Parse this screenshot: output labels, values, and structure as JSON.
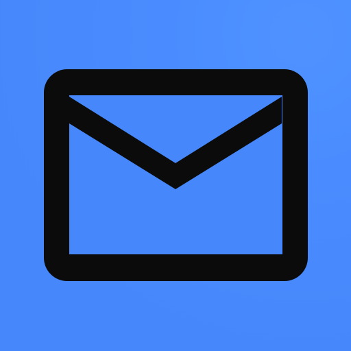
{
  "app_icon": {
    "icon": "mail-icon",
    "colors": {
      "background_primary": "#4688fb",
      "background_secondary": "#4f92ff",
      "glyph": "#0b0b0b",
      "glyph_inner": "#4688fb"
    }
  }
}
